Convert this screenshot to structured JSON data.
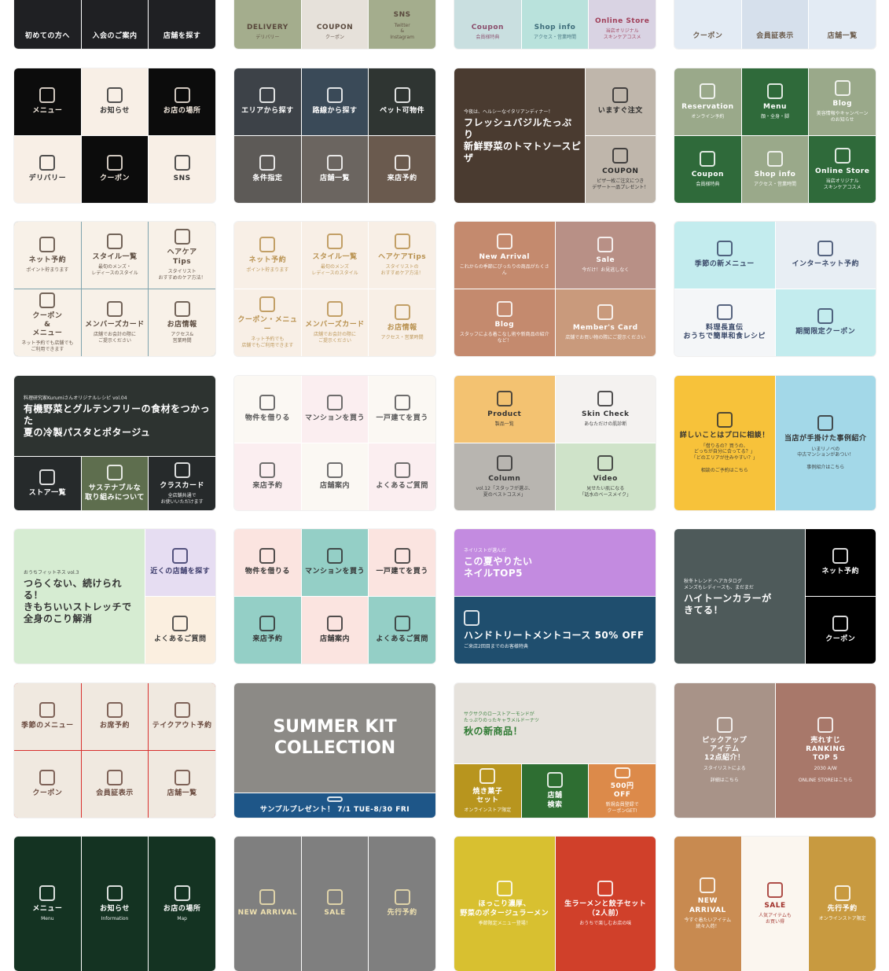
{
  "cards": [
    {
      "cells": [
        {
          "title": "初めての方へ",
          "bg": "#1f2023",
          "fg": "#ffffff"
        },
        {
          "title": "入会のご案内",
          "bg": "#1f2023",
          "fg": "#ffffff"
        },
        {
          "title": "店舗を探す",
          "bg": "#1f2023",
          "fg": "#ffffff"
        }
      ]
    },
    {
      "cells": [
        {
          "title": "DELIVERY",
          "sub": "デリバリー",
          "bg": "#a4ad8d",
          "fg": "#5a4a3e"
        },
        {
          "title": "COUPON",
          "sub": "クーポン",
          "bg": "#e6e1da",
          "fg": "#5a4a3e"
        },
        {
          "title": "SNS",
          "sub": "Twitter\n&\nInstagram",
          "bg": "#a4ad8d",
          "fg": "#5a4a3e"
        }
      ]
    },
    {
      "cells": [
        {
          "title": "Coupon",
          "sub": "会員様特典",
          "bg": "#c9dfe0",
          "fg": "#8a4c6b"
        },
        {
          "title": "Shop info",
          "sub": "アクセス・営業時間",
          "bg": "#b9e2dc",
          "fg": "#3d6c7a"
        },
        {
          "title": "Online Store",
          "sub": "当店オリジナル\nスキンケアコスメ",
          "bg": "#d9d3e3",
          "fg": "#a0405a"
        }
      ]
    },
    {
      "cells": [
        {
          "title": "クーポン",
          "bg": "#e3ebf4",
          "fg": "#6a5a4a"
        },
        {
          "title": "会員証表示",
          "bg": "#d6e0ec",
          "fg": "#6a5a4a"
        },
        {
          "title": "店舗一覧",
          "bg": "#e3ebf4",
          "fg": "#6a5a4a"
        }
      ]
    },
    {
      "cells": [
        {
          "title": "メニュー",
          "bg": "#0c0c0c",
          "fg": "#f4eadf"
        },
        {
          "title": "お知らせ",
          "bg": "#f8efe6",
          "fg": "#333333"
        },
        {
          "title": "お店の場所",
          "bg": "#0c0c0c",
          "fg": "#f4eadf"
        },
        {
          "title": "デリバリー",
          "bg": "#f8efe6",
          "fg": "#333333"
        },
        {
          "title": "クーポン",
          "bg": "#0c0c0c",
          "fg": "#f4eadf"
        },
        {
          "title": "SNS",
          "bg": "#f8efe6",
          "fg": "#333333"
        }
      ]
    },
    {
      "cells": [
        {
          "title": "エリアから探す",
          "bg": "#3d4248",
          "fg": "#ffffff"
        },
        {
          "title": "路線から探す",
          "bg": "#3a4a58",
          "fg": "#ffffff"
        },
        {
          "title": "ペット可物件",
          "bg": "#2f3532",
          "fg": "#ffffff"
        },
        {
          "title": "条件指定",
          "bg": "#5d5a57",
          "fg": "#ffffff"
        },
        {
          "title": "店舗一覧",
          "bg": "#6b6560",
          "fg": "#ffffff"
        },
        {
          "title": "来店予約",
          "bg": "#6a5a4e",
          "fg": "#ffffff"
        }
      ]
    },
    {
      "cells": [
        {
          "title": "フレッシュバジルたっぷり\n新鮮野菜のトマトソースピザ",
          "sub": "今夜は、ヘルシーなイタリアンディナー！",
          "bg": "#4a3b30",
          "fg": "#ffffff"
        },
        {
          "title": "いますぐ注文",
          "bg": "#bfb6ab",
          "fg": "#2b2b2b"
        },
        {
          "title": "COUPON",
          "sub": "ピザ一枚ご注文につき\nデザート一品プレゼント！",
          "bg": "#bfb6ab",
          "fg": "#2b2b2b"
        }
      ]
    },
    {
      "cells": [
        {
          "title": "Reservation",
          "sub": "オンライン予約",
          "bg": "#9aa98a",
          "fg": "#ffffff"
        },
        {
          "title": "Menu",
          "sub": "顔・全身・脚",
          "bg": "#2f6a3a",
          "fg": "#ffffff"
        },
        {
          "title": "Blog",
          "sub": "美容情報やキャンペーン\nのお知らせ",
          "bg": "#9aa98a",
          "fg": "#ffffff"
        },
        {
          "title": "Coupon",
          "sub": "会員様特典",
          "bg": "#2f6a3a",
          "fg": "#ffffff"
        },
        {
          "title": "Shop info",
          "sub": "アクセス・営業時間",
          "bg": "#9aa98a",
          "fg": "#ffffff"
        },
        {
          "title": "Online Store",
          "sub": "当店オリジナル\nスキンケアコスメ",
          "bg": "#2f6a3a",
          "fg": "#ffffff"
        }
      ]
    },
    {
      "cells": [
        {
          "title": "ネット予約",
          "sub": "ポイント貯まります",
          "bg": "#f8f1e8",
          "fg": "#5a4a3e"
        },
        {
          "title": "スタイル一覧",
          "sub": "最旬のメンズ・\nレディースのスタイル",
          "bg": "#f8f1e8",
          "fg": "#5a4a3e"
        },
        {
          "title": "ヘアケア\nTips",
          "sub": "スタイリスト\nおすすめのケア方法！",
          "bg": "#f8f1e8",
          "fg": "#5a4a3e"
        },
        {
          "title": "クーポン\n&\nメニュー",
          "sub": "ネット予約でも店舗でも\nご利用できます",
          "bg": "#f8f1e8",
          "fg": "#5a4a3e"
        },
        {
          "title": "メンバーズカード",
          "sub": "店舗でお会計の際に\nご提示ください",
          "bg": "#f8f1e8",
          "fg": "#5a4a3e"
        },
        {
          "title": "お店情報",
          "sub": "アクセス&\n営業時間",
          "bg": "#f8f1e8",
          "fg": "#5a4a3e"
        }
      ],
      "accent": "#7ea3ad"
    },
    {
      "cells": [
        {
          "title": "ネット予約",
          "sub": "ポイント貯まります",
          "bg": "#f8efe6",
          "fg": "#b8914f"
        },
        {
          "title": "スタイル一覧",
          "sub": "最旬のメンズ\nレディースのスタイル",
          "bg": "#f8efe6",
          "fg": "#b8914f"
        },
        {
          "title": "ヘアケアTips",
          "sub": "スタイリストの\nおすすめケア方法！",
          "bg": "#f8efe6",
          "fg": "#b8914f"
        },
        {
          "title": "クーポン・メニュー",
          "sub": "ネット予約でも\n店舗でもご利用できます",
          "bg": "#f8efe6",
          "fg": "#b8914f"
        },
        {
          "title": "メンバーズカード",
          "sub": "店舗でお会計の際に\nご提示ください",
          "bg": "#f8efe6",
          "fg": "#b8914f"
        },
        {
          "title": "お店情報",
          "sub": "アクセス・営業時間",
          "bg": "#f8efe6",
          "fg": "#b8914f"
        }
      ]
    },
    {
      "cells": [
        {
          "title": "New Arrival",
          "sub": "これからの季節にぴったりの商品がたくさん",
          "bg": "#c48a6e",
          "fg": "#ffffff"
        },
        {
          "title": "Sale",
          "sub": "今だけ！お見逃しなく",
          "bg": "#b89086",
          "fg": "#ffffff"
        },
        {
          "title": "Blog",
          "sub": "スタッフによる着こなし術や新商品の紹介など！",
          "bg": "#c48a6e",
          "fg": "#ffffff"
        },
        {
          "title": "Member's Card",
          "sub": "店舗でお買い物の際にご提示ください",
          "bg": "#c99a7c",
          "fg": "#ffffff"
        }
      ]
    },
    {
      "cells": [
        {
          "title": "季節の新メニュー",
          "bg": "#c3ecee",
          "fg": "#3b4a6a"
        },
        {
          "title": "インターネット予約",
          "bg": "#e8eef4",
          "fg": "#3b4a6a"
        },
        {
          "title": "料理長直伝\nおうちで簡単和食レシピ",
          "bg": "#f4f6f8",
          "fg": "#3b4a6a"
        },
        {
          "title": "期間限定クーポン",
          "bg": "#c3ecee",
          "fg": "#3b4a6a"
        }
      ]
    },
    {
      "cells": [
        {
          "title": "有機野菜とグルテンフリーの食材をつかった\n夏の冷製パスタとポタージュ",
          "sub": "料理研究家Kurumiさんオリジナルレシピ vol.04",
          "bg": "#2d3330",
          "fg": "#ffffff"
        },
        {
          "title": "ストア一覧",
          "bg": "#262a2b",
          "fg": "#ffffff"
        },
        {
          "title": "サステナブルな\n取り組みについて",
          "bg": "#5e6e4e",
          "fg": "#ffffff"
        },
        {
          "title": "クラスカード",
          "sub": "全店舗共通で\nお使いいただけます",
          "bg": "#262a2b",
          "fg": "#ffffff"
        }
      ]
    },
    {
      "cells": [
        {
          "title": "物件を借りる",
          "bg": "#fbf8f3",
          "fg": "#555555"
        },
        {
          "title": "マンションを買う",
          "bg": "#fbeef0",
          "fg": "#555555"
        },
        {
          "title": "一戸建てを買う",
          "bg": "#fbf8f3",
          "fg": "#555555"
        },
        {
          "title": "来店予約",
          "bg": "#fbeef0",
          "fg": "#555555"
        },
        {
          "title": "店舗案内",
          "bg": "#fbf8f3",
          "fg": "#555555"
        },
        {
          "title": "よくあるご質問",
          "bg": "#fbeef0",
          "fg": "#555555"
        }
      ]
    },
    {
      "cells": [
        {
          "title": "Product",
          "sub": "製品一覧",
          "bg": "#f3c271",
          "fg": "#333333"
        },
        {
          "title": "Skin Check",
          "sub": "あなただけの肌診断",
          "bg": "#f4f2f0",
          "fg": "#333333"
        },
        {
          "title": "Column",
          "sub": "vol.12「スタッフが選ぶ、\n夏のベストコスメ」",
          "bg": "#b8b5b0",
          "fg": "#333333"
        },
        {
          "title": "Video",
          "sub": "見せたい肌になる\n「話水のベースメイク」",
          "bg": "#cfe3c9",
          "fg": "#333333"
        }
      ]
    },
    {
      "cells": [
        {
          "title": "詳しいことはプロに相談！",
          "sub": "「借りるの？買うの、\nどっちが自分に合ってる？」\n「どのエリアが住みやすい？」\n\n相談のご予約はこちら",
          "bg": "#f7c23a",
          "fg": "#333333"
        },
        {
          "title": "当店が手掛けた事例紹介",
          "sub": "いまリノベの\n中古マンションがあつい！\n\n事例紹介はこちら",
          "bg": "#a3d8e8",
          "fg": "#333333"
        }
      ]
    },
    {
      "cells": [
        {
          "title": "つらくない、続けられる！\nきもちいいストレッチで全身のこり解消",
          "sub": "おうちフィットネス vol.3",
          "bg": "#d6ecd2",
          "fg": "#333333"
        },
        {
          "title": "近くの店舗を探す",
          "bg": "#e6ddf2",
          "fg": "#3a3a6a"
        },
        {
          "title": "よくあるご質問",
          "bg": "#fbefe0",
          "fg": "#3a3a3a"
        }
      ]
    },
    {
      "cells": [
        {
          "title": "物件を借りる",
          "bg": "#fbe4e0",
          "fg": "#333333"
        },
        {
          "title": "マンションを買う",
          "bg": "#94cfc6",
          "fg": "#333333"
        },
        {
          "title": "一戸建てを買う",
          "bg": "#fbe4e0",
          "fg": "#333333"
        },
        {
          "title": "来店予約",
          "bg": "#94cfc6",
          "fg": "#333333"
        },
        {
          "title": "店舗案内",
          "bg": "#fbe4e0",
          "fg": "#333333"
        },
        {
          "title": "よくあるご質問",
          "bg": "#94cfc6",
          "fg": "#333333"
        }
      ]
    },
    {
      "cells": [
        {
          "title": "この夏やりたい\nネイルTOP5",
          "sub": "ネイリストが選んだ",
          "bg": "#c38be0",
          "fg": "#ffffff"
        },
        {
          "title": "ハンドトリートメントコース    50% OFF",
          "sub": "ご来店2回目までのお客様特典",
          "bg": "#1f4e6e",
          "fg": "#ffffff"
        }
      ]
    },
    {
      "cells": [
        {
          "title": "ハイトーンカラーが\nきてる！",
          "sub": "秋冬トレンド ヘアカタログ\nメンズもレディースも、まだまだ",
          "bg": "#4e5a5a",
          "fg": "#ffffff"
        },
        {
          "title": "ネット予約",
          "bg": "#000000",
          "fg": "#ffffff"
        },
        {
          "title": "クーポン",
          "bg": "#000000",
          "fg": "#ffffff"
        }
      ]
    },
    {
      "cells": [
        {
          "title": "季節のメニュー",
          "bg": "#f0e9e0",
          "fg": "#6a4a3e"
        },
        {
          "title": "お席予約",
          "bg": "#f0e9e0",
          "fg": "#6a4a3e"
        },
        {
          "title": "テイクアウト予約",
          "bg": "#f0e9e0",
          "fg": "#6a4a3e"
        },
        {
          "title": "クーポン",
          "bg": "#f0e9e0",
          "fg": "#6a4a3e"
        },
        {
          "title": "会員証表示",
          "bg": "#f0e9e0",
          "fg": "#6a4a3e"
        },
        {
          "title": "店舗一覧",
          "bg": "#f0e9e0",
          "fg": "#6a4a3e"
        }
      ],
      "accent": "#d8302e"
    },
    {
      "cells": [
        {
          "title": "SUMMER KIT\nCOLLECTION",
          "bg": "#8c8a86",
          "fg": "#ffffff"
        },
        {
          "title": "サンプルプレゼント！   7/1 TUE-8/30 FRI",
          "bg": "#1e5688",
          "fg": "#ffffff"
        }
      ]
    },
    {
      "cells": [
        {
          "title": "秋の新商品！",
          "sub": "サクサクのローストアーモンドが\nたっぷりのったキャラメルドーナツ",
          "bg": "#e6e2dc",
          "fg": "#2e7a32"
        },
        {
          "title": "焼き菓子\nセット",
          "sub": "オンラインストア限定",
          "bg": "#b8951e",
          "fg": "#ffffff"
        },
        {
          "title": "店舗\n検索",
          "bg": "#2e6e32",
          "fg": "#ffffff"
        },
        {
          "title": "500円\nOFF",
          "sub": "新規会員登録で\nクーポンGET!",
          "bg": "#dc8a4a",
          "fg": "#ffffff"
        }
      ]
    },
    {
      "cells": [
        {
          "title": "ピックアップ\nアイテム\n12点紹介！",
          "sub": "スタイリストによる\n\n詳細はこちら",
          "bg": "#a89388",
          "fg": "#ffffff"
        },
        {
          "title": "売れすじ\nRANKING\nTOP 5",
          "sub": "2030 A/W\n\nONLINE STOREはこちら",
          "bg": "#a8786a",
          "fg": "#ffffff"
        }
      ]
    },
    {
      "cells": [
        {
          "title": "メニュー",
          "sub": "Menu",
          "bg": "#143322",
          "fg": "#ffffff"
        },
        {
          "title": "お知らせ",
          "sub": "Information",
          "bg": "#143322",
          "fg": "#ffffff"
        },
        {
          "title": "お店の場所",
          "sub": "Map",
          "bg": "#143322",
          "fg": "#ffffff"
        }
      ]
    },
    {
      "cells": [
        {
          "title": "NEW ARRIVAL",
          "bg": "#7f7f7f",
          "fg": "#f0e2b0"
        },
        {
          "title": "SALE",
          "bg": "#7f7f7f",
          "fg": "#f0e2b0"
        },
        {
          "title": "先行予約",
          "bg": "#7f7f7f",
          "fg": "#f0e2b0"
        }
      ]
    },
    {
      "cells": [
        {
          "title": "ほっこり濃厚、\n野菜のポタージュラーメン",
          "sub": "季節限定メニュー登場！",
          "bg": "#d8c030",
          "fg": "#ffffff"
        },
        {
          "title": "生ラーメンと餃子セット\n（2人前）",
          "sub": "おうちで楽しむお店の味",
          "bg": "#d0402a",
          "fg": "#ffffff"
        }
      ]
    },
    {
      "cells": [
        {
          "title": "NEW\nARRIVAL",
          "sub": "今すぐ着たいアイテム\n続々入荷！",
          "bg": "#c88a50",
          "fg": "#ffffff"
        },
        {
          "title": "SALE",
          "sub": "人気アイテムも\nお買い得",
          "bg": "#fbf6ef",
          "fg": "#a0302a"
        },
        {
          "title": "先行予約",
          "sub": "オンラインストア限定",
          "bg": "#c89a40",
          "fg": "#ffffff"
        }
      ]
    }
  ]
}
